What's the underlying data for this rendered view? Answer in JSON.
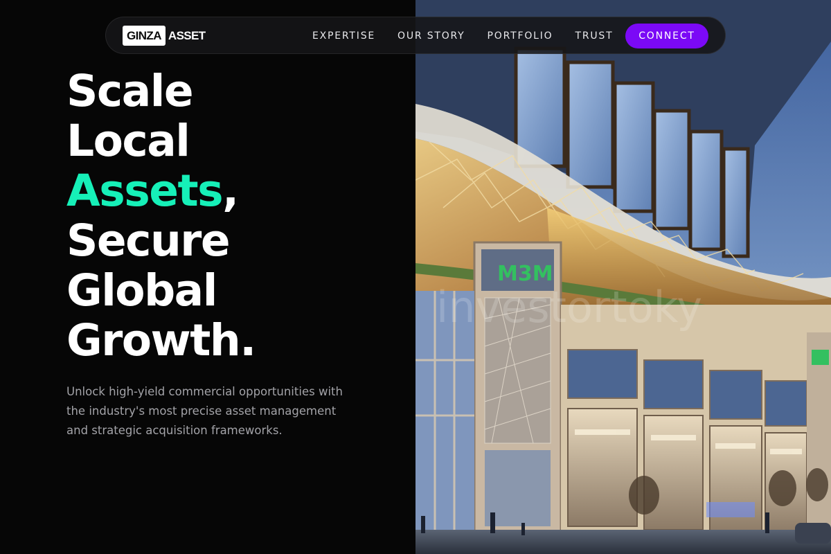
{
  "nav": {
    "logo_box": "GINZA",
    "logo_word": "ASSET",
    "links": [
      "EXPERTISE",
      "OUR STORY",
      "PORTFOLIO",
      "TRUST"
    ],
    "cta": "CONNECT"
  },
  "hero": {
    "line1": "Scale",
    "line2": "Local",
    "line3_accent": "Assets",
    "line3_rest": ",",
    "line4": "Secure",
    "line5": "Global",
    "line6": "Growth.",
    "subtext": "Unlock high-yield commercial opportunities with the industry's most precise asset management and strategic acquisition frameworks."
  },
  "image": {
    "building_sign": "M3M",
    "watermark": "investortoky"
  },
  "colors": {
    "accent": "#16f0b8",
    "cta": "#7b09f6",
    "background": "#060606"
  }
}
